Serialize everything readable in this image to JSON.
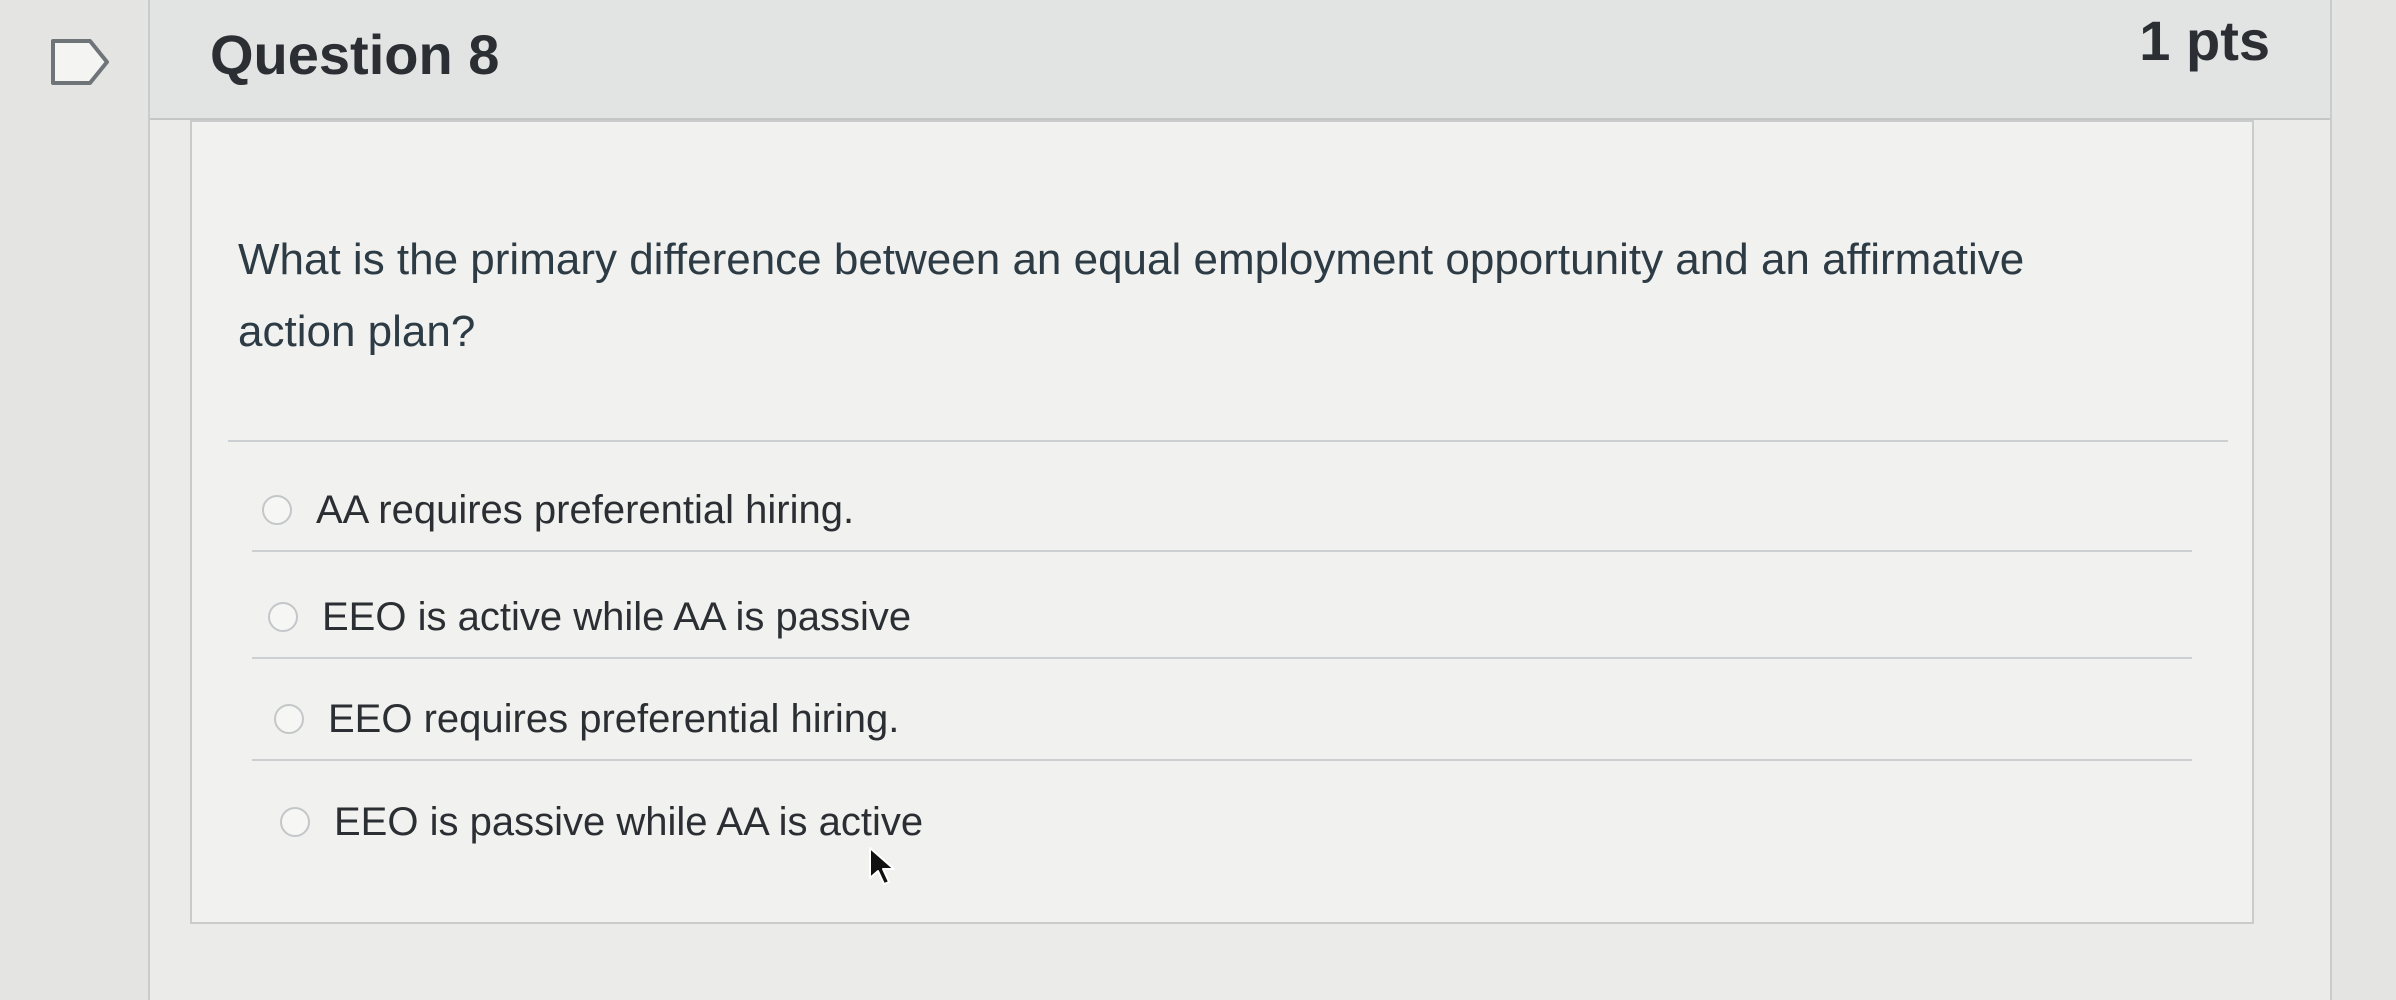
{
  "question": {
    "title": "Question 8",
    "points": "1 pts",
    "text": "What is the primary difference between an equal employment opportunity and an affirmative action plan?",
    "answers": [
      {
        "label": "AA requires preferential hiring."
      },
      {
        "label": "EEO is active while AA is passive"
      },
      {
        "label": "EEO requires preferential hiring."
      },
      {
        "label": "EEO is passive while AA is active"
      }
    ]
  },
  "icons": {
    "flag": "bookmark-flag-icon",
    "cursor": "mouse-pointer-icon",
    "radio": "radio-unselected"
  }
}
